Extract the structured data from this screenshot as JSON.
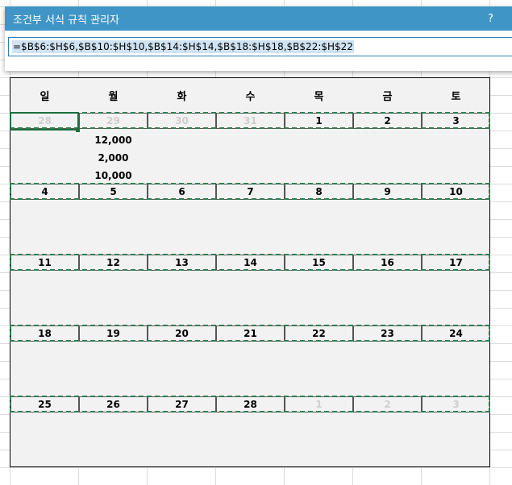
{
  "dialog": {
    "title": "조건부 서식 규칙 관리자",
    "help_label": "?",
    "formula": "=$B$6:$H$6,$B$10:$H$10,$B$14:$H$14,$B$18:$H$18,$B$22:$H$22"
  },
  "calendar": {
    "weekdays": [
      "일",
      "월",
      "화",
      "수",
      "목",
      "금",
      "토"
    ],
    "weeks": [
      {
        "days": [
          "28",
          "29",
          "30",
          "31",
          "1",
          "2",
          "3"
        ],
        "faded": [
          true,
          true,
          true,
          true,
          false,
          false,
          false
        ]
      },
      {
        "days": [
          "4",
          "5",
          "6",
          "7",
          "8",
          "9",
          "10"
        ],
        "faded": [
          false,
          false,
          false,
          false,
          false,
          false,
          false
        ]
      },
      {
        "days": [
          "11",
          "12",
          "13",
          "14",
          "15",
          "16",
          "17"
        ],
        "faded": [
          false,
          false,
          false,
          false,
          false,
          false,
          false
        ]
      },
      {
        "days": [
          "18",
          "19",
          "20",
          "21",
          "22",
          "23",
          "24"
        ],
        "faded": [
          false,
          false,
          false,
          false,
          false,
          false,
          false
        ]
      },
      {
        "days": [
          "25",
          "26",
          "27",
          "28",
          "1",
          "2",
          "3"
        ],
        "faded": [
          false,
          false,
          false,
          false,
          true,
          true,
          true
        ]
      }
    ],
    "amounts": [
      "12,000",
      "2,000",
      "10,000"
    ]
  },
  "colors": {
    "titlebar": "#3f95c5",
    "marquee": "#2e7d4f",
    "calendar_bg": "#f2f2f2",
    "faded_text": "#cfcfcf"
  }
}
